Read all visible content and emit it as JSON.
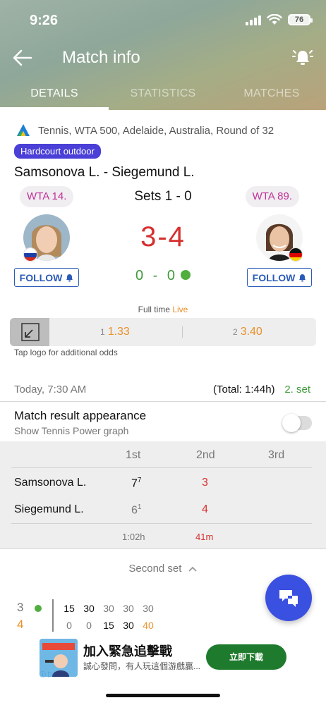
{
  "status_bar": {
    "time": "9:26",
    "battery": "76"
  },
  "header": {
    "title": "Match info",
    "tabs": [
      "DETAILS",
      "STATISTICS",
      "MATCHES"
    ]
  },
  "match": {
    "league": "Tennis, WTA 500, Adelaide, Australia, Round of 32",
    "surface": "Hardcourt outdoor",
    "title": "Samsonova L. - Siegemund L.",
    "home": {
      "rank": "WTA 14.",
      "follow": "FOLLOW"
    },
    "away": {
      "rank": "WTA 89.",
      "follow": "FOLLOW"
    },
    "sets": "Sets 1 - 0",
    "games_home": "3",
    "games_away": "4",
    "points_home": "0",
    "points_away": "0",
    "status_text": "Full time",
    "live_text": "Live"
  },
  "odds": {
    "home_num": "1",
    "home_val": "1.33",
    "away_num": "2",
    "away_val": "3.40",
    "hint": "Tap logo for additional odds"
  },
  "info": {
    "date": "Today, 7:30 AM",
    "total": "(Total: 1:44h)",
    "current_set": "2. set"
  },
  "appearance": {
    "title": "Match result appearance",
    "subtitle": "Show Tennis Power graph"
  },
  "set_table": {
    "headers": [
      "1st",
      "2nd",
      "3rd"
    ],
    "rows": [
      {
        "name": "Samsonova L.",
        "set1": "7",
        "set1_tb": "7",
        "set2": "3"
      },
      {
        "name": "Siegemund L.",
        "set1": "6",
        "set1_tb": "1",
        "set2": "4"
      }
    ],
    "durations": [
      "1:02h",
      "41m"
    ]
  },
  "second_set_label": "Second set",
  "pbp": {
    "game_home": "3",
    "game_away": "4",
    "row1": [
      "15",
      "30",
      "30",
      "30",
      "30"
    ],
    "row2": [
      "0",
      "0",
      "15",
      "30",
      "40"
    ]
  },
  "ad": {
    "title": "加入緊急追擊戰",
    "desc": "誠心發問，有人玩這個游戲贏...",
    "button": "立即下載"
  },
  "colors": {
    "accent_blue": "#2a5bb8",
    "score_red": "#d62f2f",
    "live_orange": "#e8912b",
    "green": "#3e9a3a",
    "surface_badge": "#4a3fd6"
  }
}
